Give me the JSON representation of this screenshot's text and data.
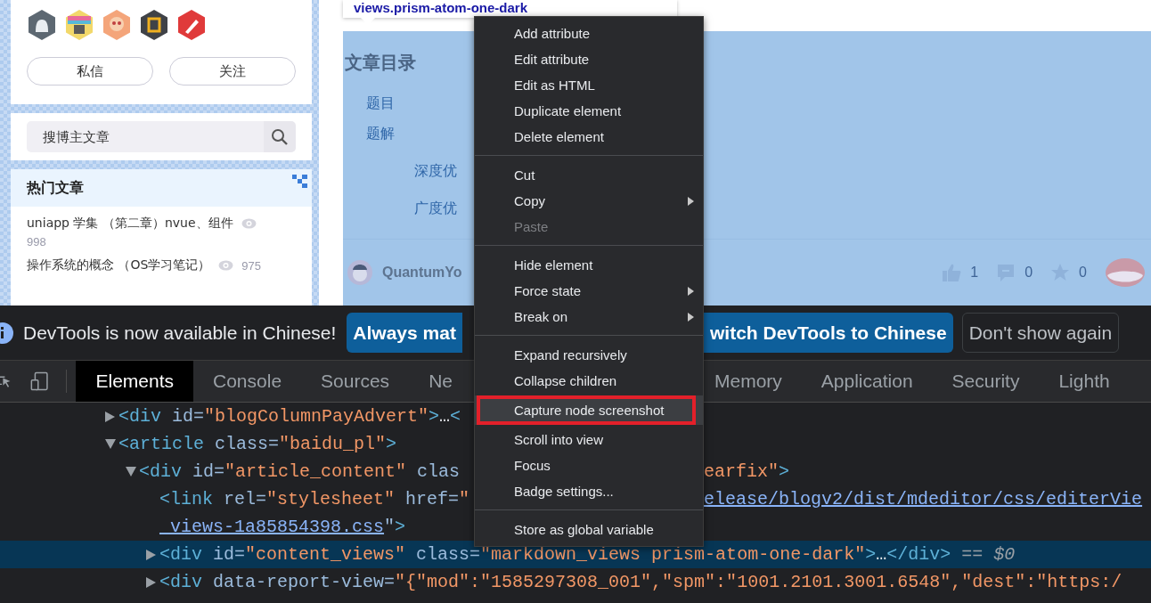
{
  "page": {
    "sidebar": {
      "profile_buttons": [
        "私信",
        "关注"
      ],
      "search": {
        "placeholder": "搜博主文章"
      },
      "hot_articles": {
        "title": "热门文章",
        "items": [
          {
            "title": "uniapp 学集 （第二章）nvue、组件",
            "views": "998"
          },
          {
            "title": "操作系统的概念 （OS学习笔记）",
            "views": "975"
          }
        ]
      }
    },
    "article": {
      "inspected": true,
      "toc_title": "文章目录",
      "toc": [
        {
          "label": "题目"
        },
        {
          "label": "题解",
          "children": [
            {
              "label": "深度优"
            },
            {
              "label": "广度优"
            }
          ]
        }
      ],
      "author": "QuantumYo",
      "likes": "1",
      "comments": "0",
      "favorites": "0"
    },
    "tooltip": {
      "selector": "views.prism-atom-one-dark"
    }
  },
  "devtools": {
    "banner": {
      "message": "DevTools is now available in Chinese!",
      "buttons": [
        {
          "label": "Always mat",
          "kind": "primary"
        },
        {
          "label": "witch DevTools to Chinese",
          "kind": "primary"
        },
        {
          "label": "Don't show again",
          "kind": "secondary"
        }
      ]
    },
    "tabs_left": [
      {
        "label": "Elements",
        "selected": true
      },
      {
        "label": "Console",
        "selected": false
      },
      {
        "label": "Sources",
        "selected": false
      },
      {
        "label": "Ne",
        "selected": false
      }
    ],
    "tabs_right": [
      {
        "label": "Memory",
        "selected": false
      },
      {
        "label": "Application",
        "selected": false
      },
      {
        "label": "Security",
        "selected": false
      },
      {
        "label": "Lighth",
        "selected": false
      }
    ],
    "dom_tree": [
      {
        "expanded": false,
        "selected": false,
        "left": [
          {
            "kind": "tag",
            "text": "<div"
          },
          {
            "kind": "attr",
            "text": " id="
          },
          {
            "kind": "value",
            "text": "\"blogColumnPayAdvert\""
          },
          {
            "kind": "tag",
            "text": ">"
          },
          {
            "kind": "text",
            "text": "…"
          },
          {
            "kind": "tag",
            "text": "<"
          }
        ]
      },
      {
        "expanded": true,
        "selected": false,
        "left": [
          {
            "kind": "tag",
            "text": "<article"
          },
          {
            "kind": "attr",
            "text": " class="
          },
          {
            "kind": "value",
            "text": "\"baidu_pl\""
          },
          {
            "kind": "tag",
            "text": ">"
          }
        ],
        "children": [
          {
            "expanded": true,
            "selected": false,
            "left": [
              {
                "kind": "tag",
                "text": "<div"
              },
              {
                "kind": "attr",
                "text": " id="
              },
              {
                "kind": "value",
                "text": "\"article_content\""
              },
              {
                "kind": "attr",
                "text": " clas"
              }
            ],
            "right": [
              {
                "kind": "value",
                "text": "earfix\""
              },
              {
                "kind": "tag",
                "text": ">"
              }
            ],
            "children": [
              {
                "selected": false,
                "left": [
                  {
                    "kind": "tag",
                    "text": "<link"
                  },
                  {
                    "kind": "attr",
                    "text": " rel="
                  },
                  {
                    "kind": "value",
                    "text": "\"stylesheet\""
                  },
                  {
                    "kind": "attr",
                    "text": " href="
                  },
                  {
                    "kind": "value",
                    "text": "\""
                  }
                ],
                "right": [
                  {
                    "kind": "link",
                    "text": "elease/blogv2/dist/mdeditor/css/editerVie"
                  }
                ],
                "wrap": [
                  {
                    "kind": "link",
                    "text": "_views-1a85854398.css"
                  },
                  {
                    "kind": "attr",
                    "text": "\""
                  },
                  {
                    "kind": "tag",
                    "text": ">"
                  }
                ]
              },
              {
                "expanded": false,
                "selected": true,
                "left": [
                  {
                    "kind": "tag",
                    "text": "<div"
                  },
                  {
                    "kind": "attr",
                    "text": " id="
                  },
                  {
                    "kind": "value",
                    "text": "\"content_views\""
                  },
                  {
                    "kind": "attr",
                    "text": " class="
                  },
                  {
                    "kind": "value",
                    "text": "\"markdown_views prism-atom-one-dark\""
                  },
                  {
                    "kind": "tag",
                    "text": ">"
                  },
                  {
                    "kind": "text",
                    "text": "…"
                  },
                  {
                    "kind": "tag",
                    "text": "</div>"
                  },
                  {
                    "kind": "marker",
                    "text": " == $0"
                  }
                ]
              },
              {
                "expanded": false,
                "selected": false,
                "left": [
                  {
                    "kind": "tag",
                    "text": "<div"
                  },
                  {
                    "kind": "attr",
                    "text": " data-report-view="
                  },
                  {
                    "kind": "value",
                    "text": "\"{\"mod\":\"1585297308_001\",\"spm\":\"1001.2101.3001.6548\",\"dest\":\"https:/"
                  }
                ]
              }
            ]
          }
        ]
      }
    ]
  },
  "context_menu": {
    "groups": [
      [
        {
          "label": "Add attribute",
          "submenu": false,
          "disabled": false,
          "highlighted": false
        },
        {
          "label": "Edit attribute",
          "submenu": false,
          "disabled": false,
          "highlighted": false
        },
        {
          "label": "Edit as HTML",
          "submenu": false,
          "disabled": false,
          "highlighted": false
        },
        {
          "label": "Duplicate element",
          "submenu": false,
          "disabled": false,
          "highlighted": false
        },
        {
          "label": "Delete element",
          "submenu": false,
          "disabled": false,
          "highlighted": false
        }
      ],
      [
        {
          "label": "Cut",
          "submenu": false,
          "disabled": false,
          "highlighted": false
        },
        {
          "label": "Copy",
          "submenu": true,
          "disabled": false,
          "highlighted": false
        },
        {
          "label": "Paste",
          "submenu": false,
          "disabled": true,
          "highlighted": false
        }
      ],
      [
        {
          "label": "Hide element",
          "submenu": false,
          "disabled": false,
          "highlighted": false
        },
        {
          "label": "Force state",
          "submenu": true,
          "disabled": false,
          "highlighted": false
        },
        {
          "label": "Break on",
          "submenu": true,
          "disabled": false,
          "highlighted": false
        }
      ],
      [
        {
          "label": "Expand recursively",
          "submenu": false,
          "disabled": false,
          "highlighted": false
        },
        {
          "label": "Collapse children",
          "submenu": false,
          "disabled": false,
          "highlighted": false
        },
        {
          "label": "Capture node screenshot",
          "submenu": false,
          "disabled": false,
          "highlighted": true
        },
        {
          "label": "Scroll into view",
          "submenu": false,
          "disabled": false,
          "highlighted": false
        },
        {
          "label": "Focus",
          "submenu": false,
          "disabled": false,
          "highlighted": false
        },
        {
          "label": "Badge settings...",
          "submenu": false,
          "disabled": false,
          "highlighted": false
        }
      ],
      [
        {
          "label": "Store as global variable",
          "submenu": false,
          "disabled": false,
          "highlighted": false
        }
      ]
    ]
  }
}
